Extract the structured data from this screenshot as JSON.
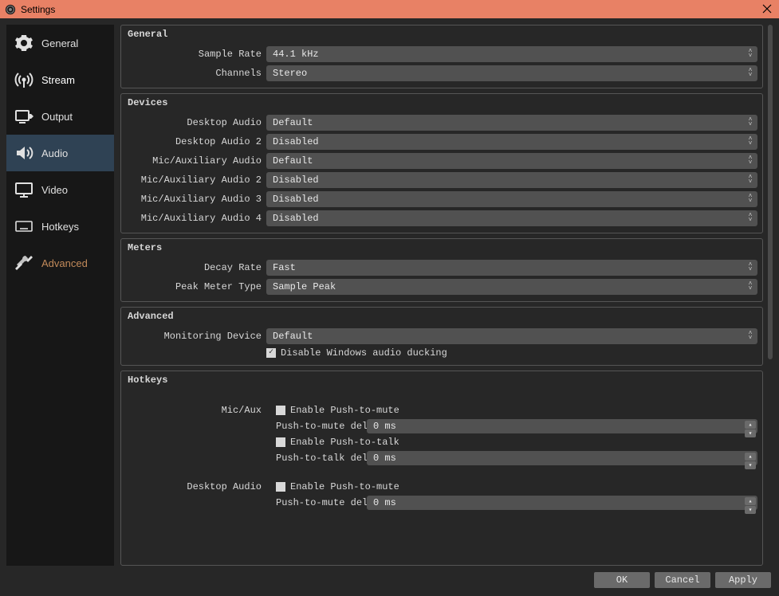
{
  "window": {
    "title": "Settings"
  },
  "sidebar": {
    "items": [
      {
        "id": "general",
        "label": "General"
      },
      {
        "id": "stream",
        "label": "Stream"
      },
      {
        "id": "output",
        "label": "Output"
      },
      {
        "id": "audio",
        "label": "Audio"
      },
      {
        "id": "video",
        "label": "Video"
      },
      {
        "id": "hotkeys",
        "label": "Hotkeys"
      },
      {
        "id": "advanced",
        "label": "Advanced"
      }
    ],
    "selected": "audio"
  },
  "sections": {
    "general": {
      "title": "General",
      "sample_rate_label": "Sample Rate",
      "sample_rate_value": "44.1 kHz",
      "channels_label": "Channels",
      "channels_value": "Stereo"
    },
    "devices": {
      "title": "Devices",
      "desktop_audio_label": "Desktop Audio",
      "desktop_audio_value": "Default",
      "desktop_audio2_label": "Desktop Audio 2",
      "desktop_audio2_value": "Disabled",
      "mic_aux_label": "Mic/Auxiliary Audio",
      "mic_aux_value": "Default",
      "mic_aux2_label": "Mic/Auxiliary Audio 2",
      "mic_aux2_value": "Disabled",
      "mic_aux3_label": "Mic/Auxiliary Audio 3",
      "mic_aux3_value": "Disabled",
      "mic_aux4_label": "Mic/Auxiliary Audio 4",
      "mic_aux4_value": "Disabled"
    },
    "meters": {
      "title": "Meters",
      "decay_rate_label": "Decay Rate",
      "decay_rate_value": "Fast",
      "peak_meter_label": "Peak Meter Type",
      "peak_meter_value": "Sample Peak"
    },
    "advanced": {
      "title": "Advanced",
      "monitoring_device_label": "Monitoring Device",
      "monitoring_device_value": "Default",
      "disable_ducking_label": "Disable Windows audio ducking",
      "disable_ducking_checked": true
    },
    "hotkeys": {
      "title": "Hotkeys",
      "mic_aux_label": "Mic/Aux",
      "desktop_audio_label": "Desktop Audio",
      "enable_push_to_mute_label": "Enable Push-to-mute",
      "push_to_mute_delay_label": "Push-to-mute delay",
      "enable_push_to_talk_label": "Enable Push-to-talk",
      "push_to_talk_delay_label": "Push-to-talk delay",
      "delay_value_mic_mute": "0",
      "delay_value_mic_talk": "0",
      "delay_value_desktop_mute": "0",
      "delay_unit": "ms"
    }
  },
  "buttons": {
    "ok": "OK",
    "cancel": "Cancel",
    "apply": "Apply"
  }
}
